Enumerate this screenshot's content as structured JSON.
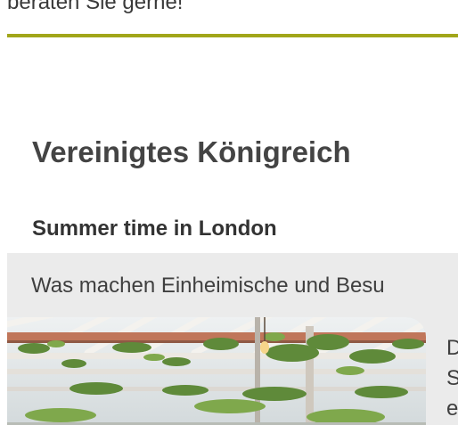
{
  "top_text": "beraten Sie gerne!",
  "accent_color": "#a1a61a",
  "section": {
    "heading": "Vereinigtes Königreich"
  },
  "card": {
    "title": "Summer time in London",
    "teaser": "Was machen Einheimische und Besu",
    "image_alt": "Rooftop garden pergola with hanging plants and lights",
    "body_text": "D\nS\ne"
  }
}
